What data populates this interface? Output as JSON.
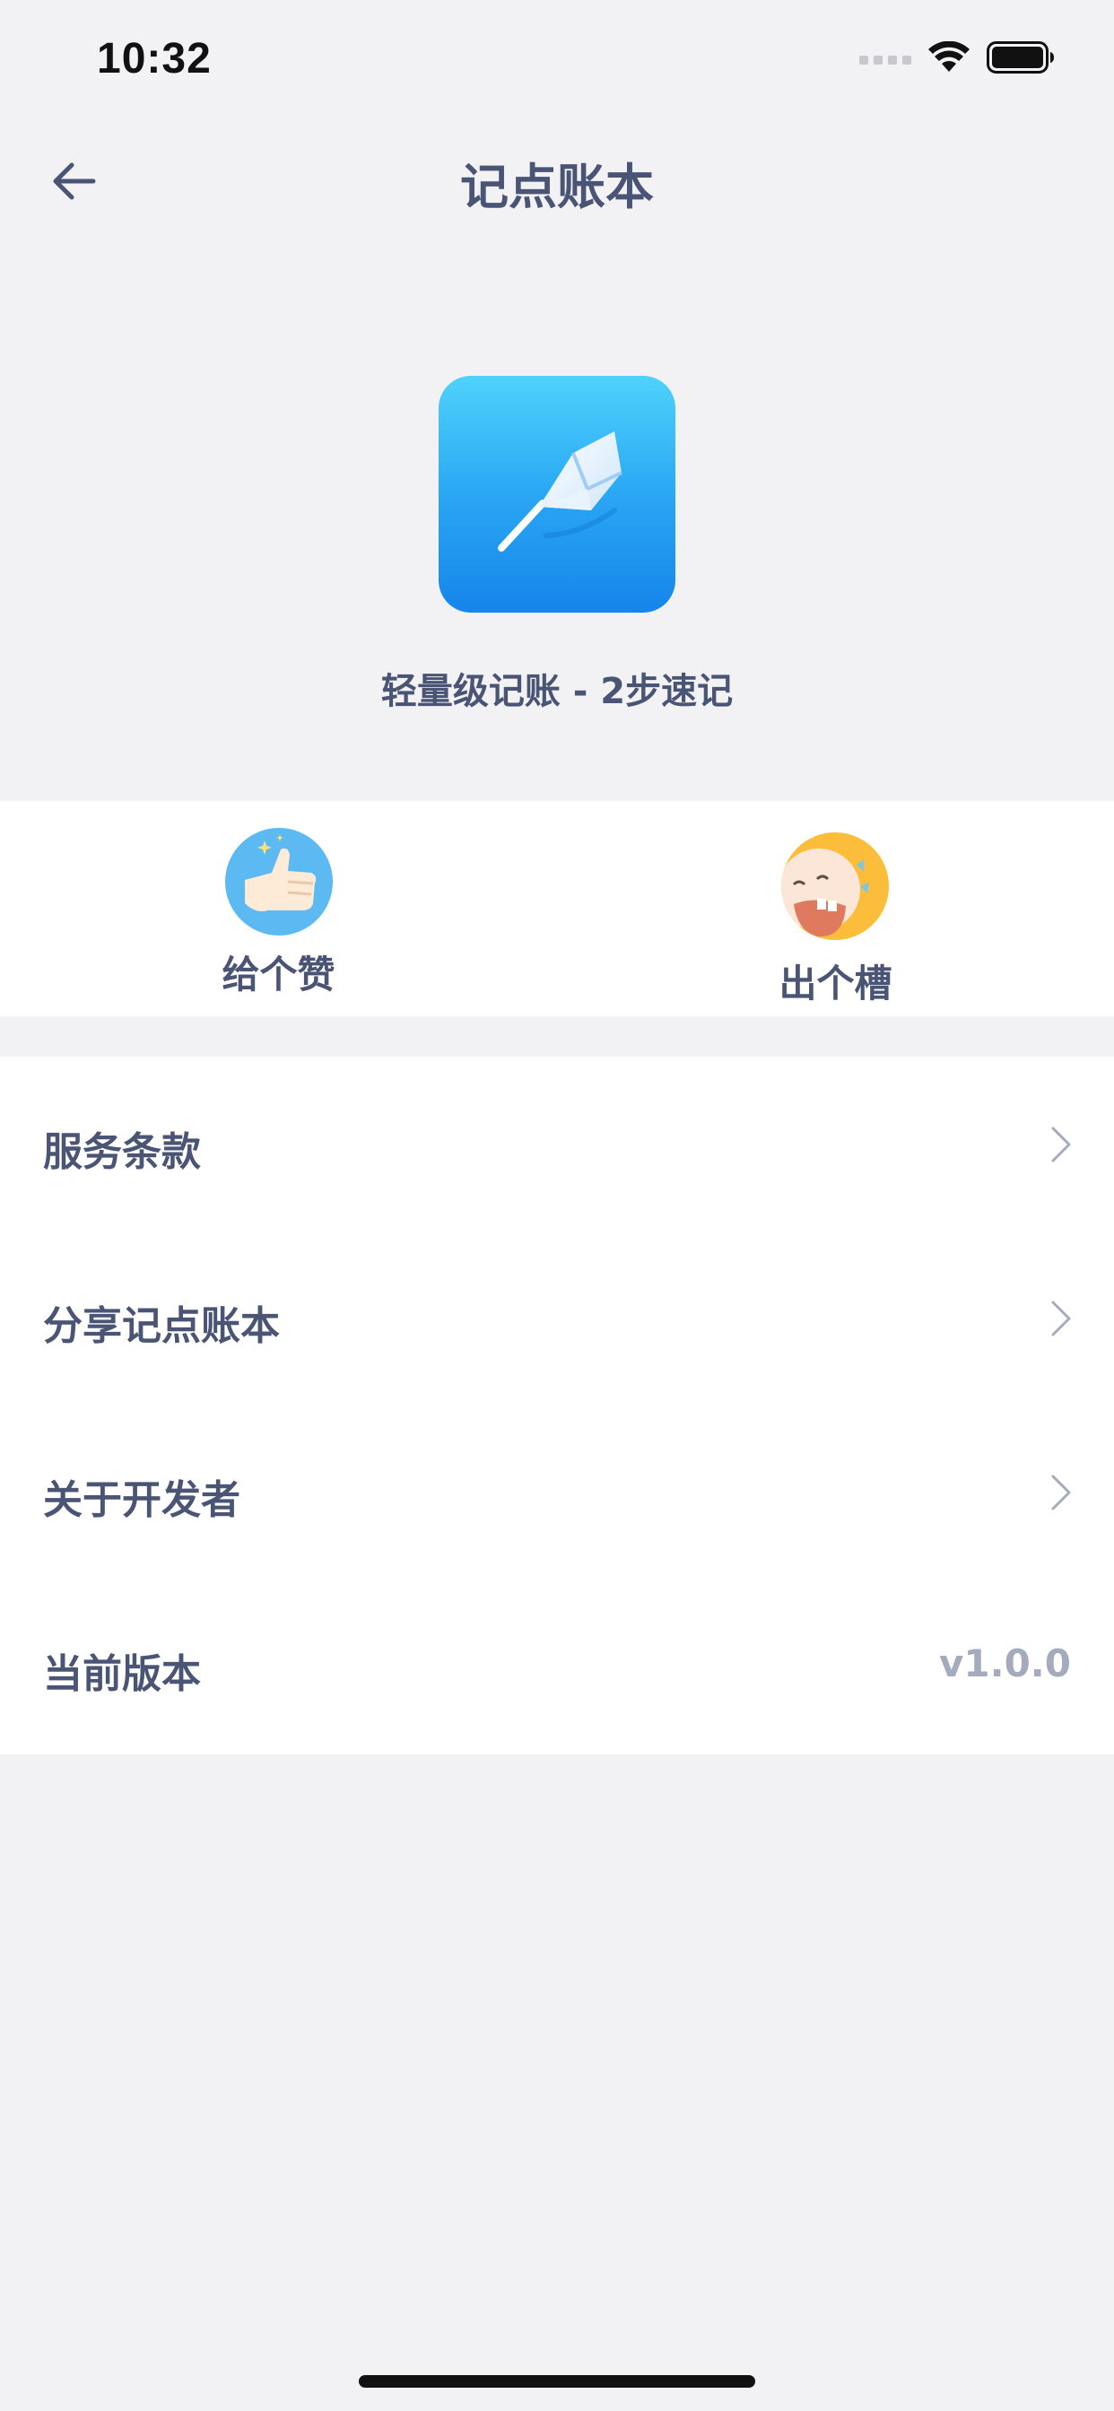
{
  "status_bar": {
    "time": "10:32",
    "icons": [
      "signal-icon",
      "wifi-icon",
      "battery-icon"
    ]
  },
  "nav": {
    "title": "记点账本",
    "back_icon": "arrow-left-icon"
  },
  "app": {
    "icon": "feather-pen-icon",
    "tagline": "轻量级记账 - 2步速记"
  },
  "actions": [
    {
      "label": "给个赞",
      "icon": "thumbs-up-icon"
    },
    {
      "label": "出个槽",
      "icon": "laughing-face-icon"
    }
  ],
  "menu": {
    "items": [
      {
        "label": "服务条款",
        "chevron": true
      },
      {
        "label": "分享记点账本",
        "chevron": true
      },
      {
        "label": "关于开发者",
        "chevron": true
      },
      {
        "label": "当前版本",
        "value": "v1.0.0"
      }
    ]
  },
  "colors": {
    "text_primary": "#4a5474",
    "text_secondary": "#a3abbd",
    "background": "#f2f2f5",
    "panel": "#ffffff",
    "app_icon_top": "#4fd2fb",
    "app_icon_bottom": "#1585ea"
  }
}
